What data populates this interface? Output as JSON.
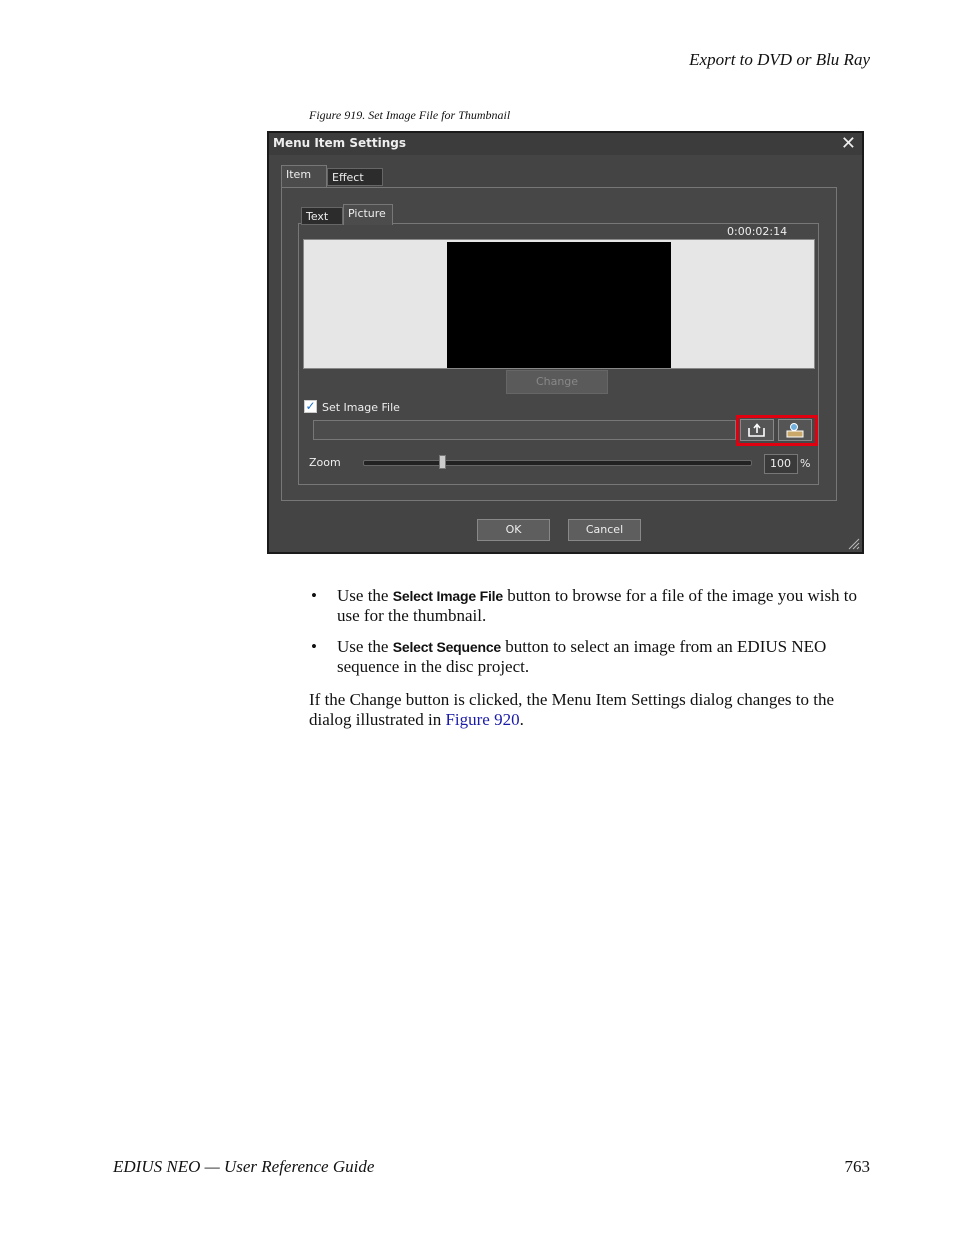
{
  "header": {
    "section": "Export to DVD or Blu Ray"
  },
  "figure": {
    "caption": "Figure 919.  Set Image File for Thumbnail"
  },
  "dialog": {
    "title": "Menu Item Settings",
    "close_glyph": "✕",
    "tabs": [
      "Item",
      "Effect"
    ],
    "subtabs": [
      "Text",
      "Picture"
    ],
    "timecode": "0:00:02:14",
    "change_label": "Change",
    "set_image_file_label": "Set Image File",
    "set_image_file_checked": true,
    "file_path": "",
    "zoom_label": "Zoom",
    "zoom_value": "100",
    "zoom_unit": "%",
    "zoom_slider_fraction": 0.2,
    "ok_label": "OK",
    "cancel_label": "Cancel",
    "icons": {
      "select_image_file": "folder-open-icon",
      "select_sequence": "sequence-icon"
    },
    "highlight_color": "#e00010"
  },
  "bullets": [
    {
      "prefix": "Use the ",
      "term": "Select Image File",
      "suffix": " button to browse for a file of the image you wish to use for the thumbnail."
    },
    {
      "prefix": "Use the ",
      "term": "Select Sequence",
      "suffix": " button to select an image from an EDIUS NEO sequence in the disc project."
    }
  ],
  "paragraph": {
    "text": "If the Change button is clicked, the Menu Item Settings dialog changes to the dialog illustrated in ",
    "link_text": "Figure 920",
    "end": "."
  },
  "footer": {
    "left": "EDIUS NEO  —  User Reference Guide",
    "page_number": "763"
  }
}
